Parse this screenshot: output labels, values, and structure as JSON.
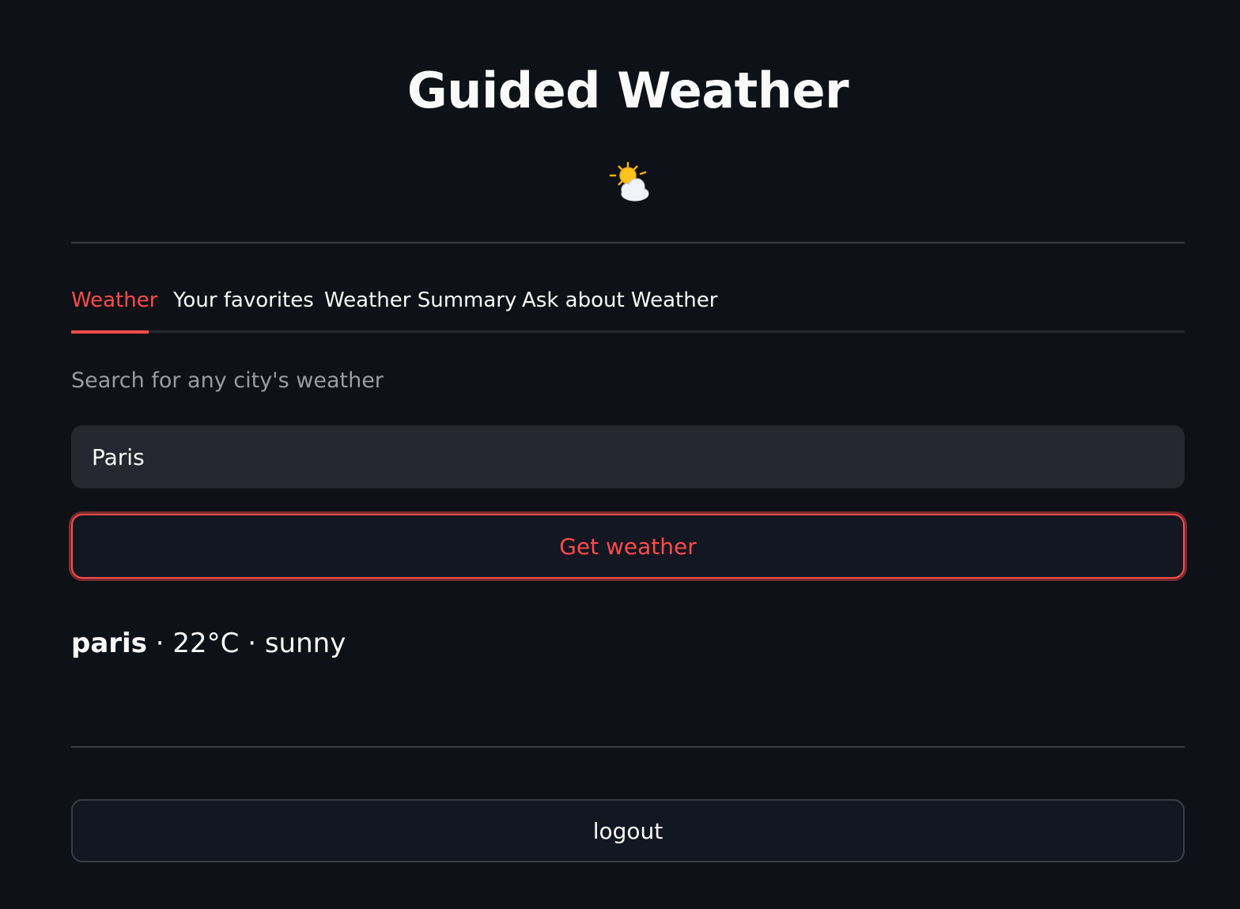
{
  "app": {
    "title": "Guided Weather",
    "hero_icon": "sun-behind-cloud-icon"
  },
  "tabs": [
    {
      "label": "Weather",
      "active": true
    },
    {
      "label": "Your favorites",
      "active": false
    },
    {
      "label": "Weather Summary",
      "active": false
    },
    {
      "label": "Ask about Weather",
      "active": false
    }
  ],
  "weather_tab": {
    "caption": "Search for any city's weather",
    "search_input_value": "Paris",
    "get_weather_label": "Get weather",
    "result": {
      "city": "paris",
      "separator": "·",
      "temperature": "22°C",
      "condition": "sunny"
    }
  },
  "footer": {
    "logout_label": "logout"
  },
  "colors": {
    "background": "#0e1117",
    "accent": "#ff4b4b",
    "input_background": "#262730",
    "text": "#fafafa",
    "muted_text": "#9a9ca3"
  }
}
